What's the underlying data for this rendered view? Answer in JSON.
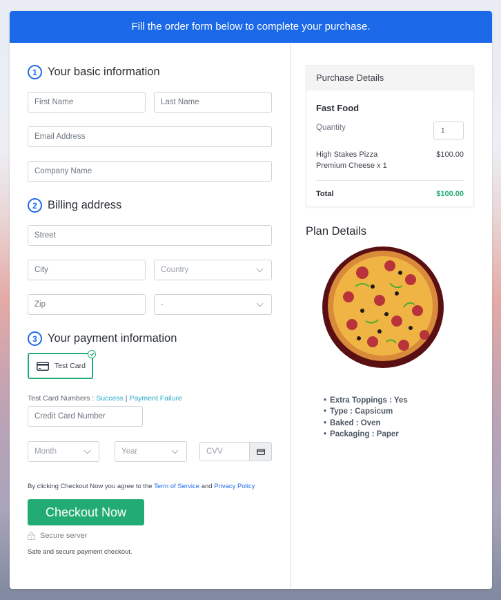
{
  "banner": {
    "text": "Fill the order form below to complete your purchase."
  },
  "sections": {
    "basic": {
      "step": "1",
      "title": "Your basic information"
    },
    "billing": {
      "step": "2",
      "title": "Billing address"
    },
    "payment": {
      "step": "3",
      "title": "Your payment information"
    }
  },
  "fields": {
    "first_name": "First Name",
    "last_name": "Last Name",
    "email": "Email Address",
    "company": "Company Name",
    "street": "Street",
    "city": "City",
    "country": "Country",
    "zip": "Zip",
    "state": "-",
    "card_number": "Credit Card Number",
    "month": "Month",
    "year": "Year",
    "cvv": "CVV"
  },
  "payment": {
    "method_label": "Test Card",
    "test_numbers_label": "Test Card Numbers : ",
    "success_link": "Success",
    "separator": " | ",
    "failure_link": "Payment Failure"
  },
  "footer": {
    "agree_prefix": "By clicking Checkout Now you agree to the ",
    "terms_link": "Term of Service",
    "and": " and ",
    "privacy_link": "Privacy Policy",
    "checkout_label": "Checkout Now",
    "secure_label": "Secure server",
    "safe_text": "Safe and secure payment checkout."
  },
  "purchase": {
    "header": "Purchase Details",
    "category": "Fast Food",
    "quantity_label": "Quantity",
    "quantity_value": "1",
    "item_line1": "High Stakes Pizza",
    "item_line2": "Premium Cheese x 1",
    "item_price": "$100.00",
    "total_label": "Total",
    "total_value": "$100.00"
  },
  "plan": {
    "title": "Plan Details",
    "features": [
      "Extra Toppings : Yes",
      "Type : Capsicum",
      "Baked : Oven",
      "Packaging : Paper"
    ]
  },
  "colors": {
    "brand_blue": "#1b69e8",
    "accent_green": "#22ac73",
    "link_teal": "#27a9c9"
  }
}
